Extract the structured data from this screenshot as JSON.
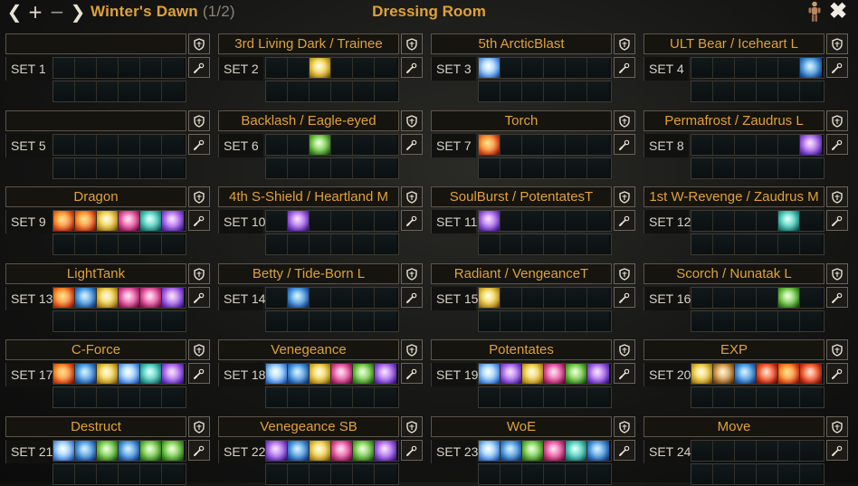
{
  "header": {
    "loadout_name": "Winter's Dawn",
    "loadout_counter": "(1/2)",
    "app_title": "Dressing Room",
    "icons": {
      "prev": "chevron-left-icon",
      "add": "plus-icon",
      "remove": "minus-icon",
      "next": "chevron-right-icon",
      "character": "character-figure-icon",
      "close": "close-icon"
    }
  },
  "sets": [
    {
      "label": "SET 1",
      "name": "",
      "skills": []
    },
    {
      "label": "SET 2",
      "name": "3rd Living Dark / Trainee",
      "skills": [
        {
          "slot": 2,
          "icon": "gold"
        }
      ]
    },
    {
      "label": "SET 3",
      "name": "5th ArcticBlast",
      "skills": [
        {
          "slot": 0,
          "icon": "frost"
        }
      ]
    },
    {
      "label": "SET 4",
      "name": "ULT Bear / Iceheart L",
      "skills": [
        {
          "slot": 5,
          "icon": "blue"
        }
      ]
    },
    {
      "label": "SET 5",
      "name": "",
      "skills": []
    },
    {
      "label": "SET 6",
      "name": "Backlash / Eagle-eyed",
      "skills": [
        {
          "slot": 2,
          "icon": "green"
        }
      ]
    },
    {
      "label": "SET 7",
      "name": "Torch",
      "skills": [
        {
          "slot": 0,
          "icon": "fire"
        }
      ]
    },
    {
      "label": "SET 8",
      "name": "Permafrost / Zaudrus L",
      "skills": [
        {
          "slot": 5,
          "icon": "purple"
        }
      ]
    },
    {
      "label": "SET 9",
      "name": "Dragon",
      "skills": [
        {
          "slot": 0,
          "icon": "fire"
        },
        {
          "slot": 1,
          "icon": "fire"
        },
        {
          "slot": 2,
          "icon": "gold"
        },
        {
          "slot": 3,
          "icon": "pink"
        },
        {
          "slot": 4,
          "icon": "teal"
        },
        {
          "slot": 5,
          "icon": "purple"
        }
      ]
    },
    {
      "label": "SET 10",
      "name": "4th S-Shield / Heartland M",
      "skills": [
        {
          "slot": 1,
          "icon": "purple"
        }
      ]
    },
    {
      "label": "SET 11",
      "name": "SoulBurst / PotentatesT",
      "skills": [
        {
          "slot": 0,
          "icon": "purple"
        }
      ]
    },
    {
      "label": "SET 12",
      "name": "1st W-Revenge / Zaudrus M",
      "skills": [
        {
          "slot": 4,
          "icon": "teal"
        }
      ]
    },
    {
      "label": "SET 13",
      "name": "LightTank",
      "skills": [
        {
          "slot": 0,
          "icon": "fire"
        },
        {
          "slot": 1,
          "icon": "blue"
        },
        {
          "slot": 2,
          "icon": "gold"
        },
        {
          "slot": 3,
          "icon": "pink"
        },
        {
          "slot": 4,
          "icon": "pink"
        },
        {
          "slot": 5,
          "icon": "purple"
        }
      ]
    },
    {
      "label": "SET 14",
      "name": "Betty / Tide-Born L",
      "skills": [
        {
          "slot": 1,
          "icon": "blue"
        }
      ]
    },
    {
      "label": "SET 15",
      "name": "Radiant / VengeanceT",
      "skills": [
        {
          "slot": 0,
          "icon": "gold"
        }
      ]
    },
    {
      "label": "SET 16",
      "name": "Scorch / Nunatak L",
      "skills": [
        {
          "slot": 4,
          "icon": "green"
        }
      ]
    },
    {
      "label": "SET 17",
      "name": "C-Force",
      "skills": [
        {
          "slot": 0,
          "icon": "fire"
        },
        {
          "slot": 1,
          "icon": "blue"
        },
        {
          "slot": 2,
          "icon": "gold"
        },
        {
          "slot": 3,
          "icon": "frost"
        },
        {
          "slot": 4,
          "icon": "teal"
        },
        {
          "slot": 5,
          "icon": "purple"
        }
      ]
    },
    {
      "label": "SET 18",
      "name": "Venegeance",
      "skills": [
        {
          "slot": 0,
          "icon": "frost"
        },
        {
          "slot": 1,
          "icon": "blue"
        },
        {
          "slot": 2,
          "icon": "gold"
        },
        {
          "slot": 3,
          "icon": "pink"
        },
        {
          "slot": 4,
          "icon": "green"
        },
        {
          "slot": 5,
          "icon": "purple"
        }
      ]
    },
    {
      "label": "SET 19",
      "name": "Potentates",
      "skills": [
        {
          "slot": 0,
          "icon": "frost"
        },
        {
          "slot": 1,
          "icon": "purple"
        },
        {
          "slot": 2,
          "icon": "gold"
        },
        {
          "slot": 3,
          "icon": "pink"
        },
        {
          "slot": 4,
          "icon": "green"
        },
        {
          "slot": 5,
          "icon": "purple"
        }
      ]
    },
    {
      "label": "SET 20",
      "name": "EXP",
      "skills": [
        {
          "slot": 0,
          "icon": "gold"
        },
        {
          "slot": 1,
          "icon": "brown"
        },
        {
          "slot": 2,
          "icon": "blue"
        },
        {
          "slot": 3,
          "icon": "red"
        },
        {
          "slot": 4,
          "icon": "fire"
        },
        {
          "slot": 5,
          "icon": "red"
        }
      ]
    },
    {
      "label": "SET 21",
      "name": "Destruct",
      "skills": [
        {
          "slot": 0,
          "icon": "frost"
        },
        {
          "slot": 1,
          "icon": "blue"
        },
        {
          "slot": 2,
          "icon": "green"
        },
        {
          "slot": 3,
          "icon": "blue"
        },
        {
          "slot": 4,
          "icon": "green"
        },
        {
          "slot": 5,
          "icon": "green"
        }
      ]
    },
    {
      "label": "SET 22",
      "name": "Venegeance SB",
      "skills": [
        {
          "slot": 0,
          "icon": "purple"
        },
        {
          "slot": 1,
          "icon": "blue"
        },
        {
          "slot": 2,
          "icon": "gold"
        },
        {
          "slot": 3,
          "icon": "pink"
        },
        {
          "slot": 4,
          "icon": "green"
        },
        {
          "slot": 5,
          "icon": "purple"
        }
      ]
    },
    {
      "label": "SET 23",
      "name": "WoE",
      "skills": [
        {
          "slot": 0,
          "icon": "frost"
        },
        {
          "slot": 1,
          "icon": "blue"
        },
        {
          "slot": 2,
          "icon": "green"
        },
        {
          "slot": 3,
          "icon": "pink"
        },
        {
          "slot": 4,
          "icon": "teal"
        },
        {
          "slot": 5,
          "icon": "blue"
        }
      ]
    },
    {
      "label": "SET 24",
      "name": "Move",
      "skills": []
    }
  ],
  "set_icons": {
    "shield": "shield-icon",
    "tool": "wrench-icon"
  }
}
